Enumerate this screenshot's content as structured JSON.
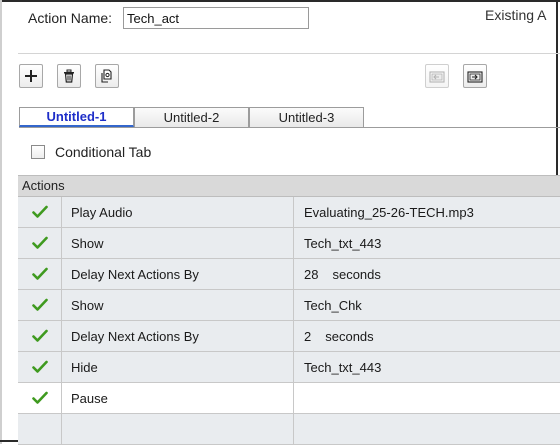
{
  "header": {
    "action_name_label": "Action Name:",
    "action_name_value": "Tech_act",
    "existing_label": "Existing A"
  },
  "toolbar": {
    "add_icon": "plus-icon",
    "delete_icon": "trash-icon",
    "copy_icon": "copy-icon",
    "import_icon": "import-icon",
    "export_icon": "export-icon"
  },
  "tabs": [
    {
      "label": "Untitled-1",
      "active": true
    },
    {
      "label": "Untitled-2",
      "active": false
    },
    {
      "label": "Untitled-3",
      "active": false
    }
  ],
  "conditional": {
    "label": "Conditional Tab",
    "checked": false
  },
  "table": {
    "header": "Actions",
    "rows": [
      {
        "action": "Play Audio",
        "value": "Evaluating_25-26-TECH.mp3",
        "unit": ""
      },
      {
        "action": "Show",
        "value": "Tech_txt_443",
        "unit": ""
      },
      {
        "action": "Delay Next Actions By",
        "value": "28",
        "unit": "seconds"
      },
      {
        "action": "Show",
        "value": "Tech_Chk",
        "unit": ""
      },
      {
        "action": "Delay Next Actions By",
        "value": "2",
        "unit": "seconds"
      },
      {
        "action": "Hide",
        "value": "Tech_txt_443",
        "unit": ""
      },
      {
        "action": "Pause",
        "value": "",
        "unit": ""
      }
    ]
  },
  "colors": {
    "check": "#3f9a1f",
    "active_tab": "#1e2ec8",
    "header_bg": "#d9d9d9",
    "alt_row": "#e9ecef"
  }
}
